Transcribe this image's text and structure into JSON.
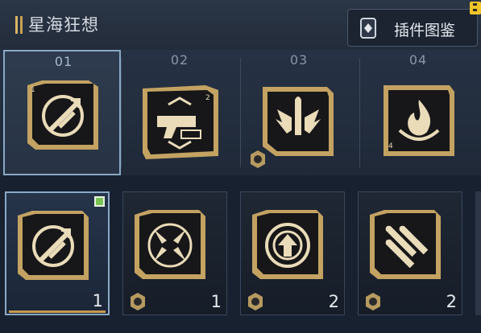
{
  "header": {
    "title": "星海狂想",
    "gallery_button": "插件图鉴",
    "gallery_icon": "card-icon",
    "notification_icon": "notification-icon"
  },
  "slots": [
    {
      "number": "01",
      "selected": true,
      "icon": "missile-ring-icon",
      "gear": false
    },
    {
      "number": "02",
      "selected": false,
      "icon": "pistol-icon",
      "gear": false
    },
    {
      "number": "03",
      "selected": false,
      "icon": "winged-bullet-icon",
      "gear": true
    },
    {
      "number": "04",
      "selected": false,
      "icon": "flame-icon",
      "gear": false
    }
  ],
  "inventory": [
    {
      "quantity": "1",
      "icon": "missile-ring-icon",
      "equipped": true,
      "gear": false
    },
    {
      "quantity": "1",
      "icon": "arrows-converge-icon",
      "equipped": false,
      "gear": true
    },
    {
      "quantity": "2",
      "icon": "target-up-icon",
      "equipped": false,
      "gear": true
    },
    {
      "quantity": "2",
      "icon": "triple-missile-icon",
      "equipped": false,
      "gear": true
    }
  ],
  "colors": {
    "gold": "#d9b565",
    "card_dark": "#1a1a1c",
    "selection": "#8aa9c5",
    "equipped_check": "#79c354"
  }
}
